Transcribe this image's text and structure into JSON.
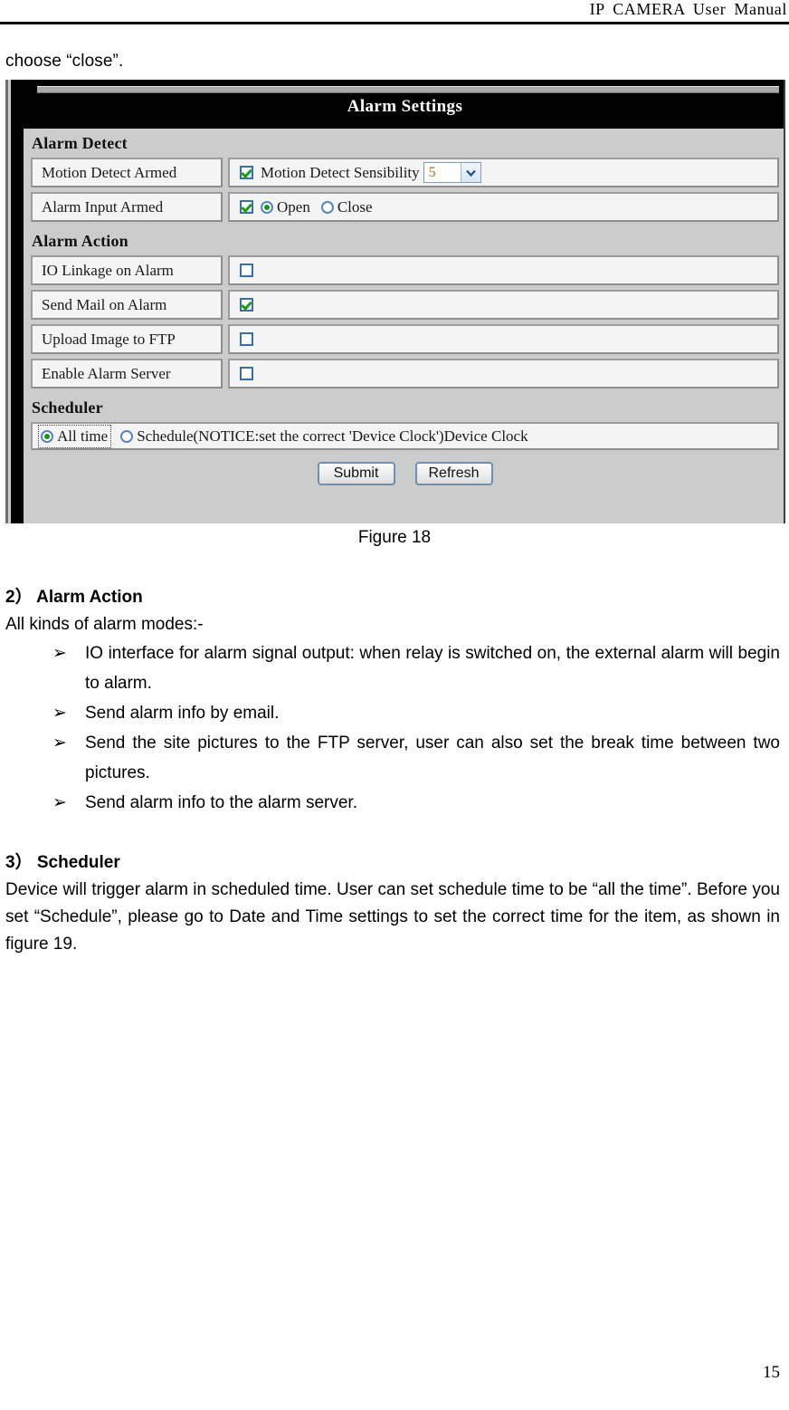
{
  "header": {
    "running_title": "IP  CAMERA  User  Manual"
  },
  "intro": {
    "line": "choose “close”."
  },
  "figure": {
    "caption": "Figure 18",
    "panel": {
      "title": "Alarm Settings",
      "groups": [
        {
          "title": "Alarm Detect",
          "rows": [
            {
              "label": "Motion Detect Armed",
              "checkbox_checked": true,
              "field_text": "Motion Detect Sensibility",
              "select_value": "5"
            },
            {
              "label": "Alarm Input Armed",
              "checkbox_checked": true,
              "radio_open": "Open",
              "radio_close": "Close",
              "selected": "Open"
            }
          ]
        },
        {
          "title": "Alarm Action",
          "rows": [
            {
              "label": "IO Linkage on Alarm",
              "checkbox_checked": false
            },
            {
              "label": "Send Mail on Alarm",
              "checkbox_checked": true
            },
            {
              "label": "Upload Image to FTP",
              "checkbox_checked": false
            },
            {
              "label": "Enable Alarm Server",
              "checkbox_checked": false
            }
          ]
        },
        {
          "title": "Scheduler",
          "scheduler": {
            "option_all_time": "All time",
            "option_schedule": "Schedule(NOTICE:set the correct 'Device Clock')Device Clock",
            "selected": "All time"
          }
        }
      ],
      "buttons": {
        "submit": "Submit",
        "refresh": "Refresh"
      }
    }
  },
  "sections": [
    {
      "number": "2）",
      "title": "Alarm Action",
      "intro": "All kinds of alarm modes:-",
      "bullets": [
        "IO interface for alarm signal output: when relay is switched on, the external alarm will begin to alarm.",
        "Send alarm info by email.",
        "Send the site pictures to the FTP server, user can also set the break time between two pictures.",
        "Send alarm info to the alarm server."
      ]
    },
    {
      "number": "3）",
      "title": "Scheduler",
      "paragraph": "Device will trigger alarm in scheduled time. User can set schedule time to be “all the time”. Before you set “Schedule”, please go to Date and Time settings to set the correct time for the item, as shown in figure 19."
    }
  ],
  "bullet_glyph": "➢",
  "page_number": "15"
}
